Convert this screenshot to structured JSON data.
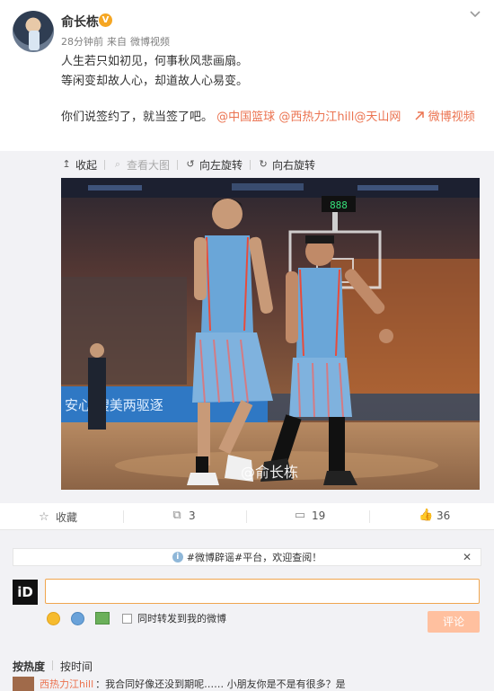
{
  "post": {
    "username": "俞长栋",
    "verified_badge": "V",
    "meta": {
      "time": "28分钟前",
      "from": "来自",
      "source": "微博视频"
    },
    "lines": [
      "人生若只如初见，何事秋风悲画扇。",
      "等闲变却故人心，却道故人心易变。"
    ],
    "line3_text": "你们说签约了，就当签了吧。",
    "mentions": [
      "@中国篮球",
      "@西热力江hill",
      "@天山网"
    ],
    "video_link": "微博视频",
    "photo_watermark": "@俞长栋",
    "photo_court_banner": "安心  嫂美两驱逐",
    "photo_scoreboard": "888",
    "colors": {
      "link": "#eb7350",
      "page_bg": "#f2f2f5",
      "jersey": "#6aa6d8"
    }
  },
  "toolbar": {
    "collapse": "收起",
    "view_large": "查看大图",
    "rotate_left": "向左旋转",
    "rotate_right": "向右旋转"
  },
  "actions": {
    "favorite": "收藏",
    "repost_count": "3",
    "comment_count": "19",
    "like_count": "36"
  },
  "comments": {
    "notice": "#微博辟谣#平台，欢迎查阅！",
    "repost_checkbox": "同时转发到我的微博",
    "submit": "评论",
    "tab_hot": "按热度",
    "tab_time": "按时间",
    "first_comment_user": "西热力江hill",
    "first_comment_text": "：我合同好像还没到期呢…… 小朋友你是不是有很多？是"
  },
  "user_avatar_text": "iD"
}
